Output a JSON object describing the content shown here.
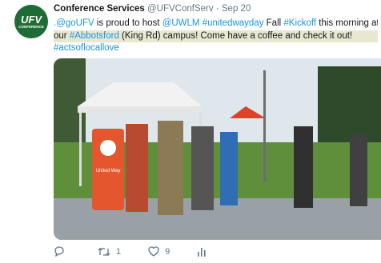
{
  "tweet": {
    "author": {
      "name": "Conference Services",
      "handle": "@UFVConfServ",
      "avatar_abbr": "UFV",
      "avatar_text": "CONFERENCE"
    },
    "separator": "·",
    "date": "Sep 20",
    "text": {
      "l1_mention1": ".@goUFV",
      "l1_plain1": " is proud to host ",
      "l1_mention2": "@UWLM",
      "l1_space": " ",
      "l1_tag1": "#unitedwayday",
      "l1_plain2": " Fall ",
      "l1_tag2": "#Kickoff",
      "l1_plain3": " this morning at",
      "l2_plain1": "our ",
      "l2_tag1": "#Abbotsford",
      "l2_plain2": " (King Rd) campus! Come have a coffee and check it out!",
      "l3_tag1": "#actsoflocallove"
    },
    "photo": {
      "sign_label": "United Way",
      "colors": {
        "sky": "#dfe6ec",
        "grass": "#5f8f3a",
        "tent": "#f2f2f2",
        "sign": "#e4572e"
      }
    },
    "actions": {
      "reply_count": "",
      "retweet_count": "1",
      "like_count": "9"
    }
  }
}
